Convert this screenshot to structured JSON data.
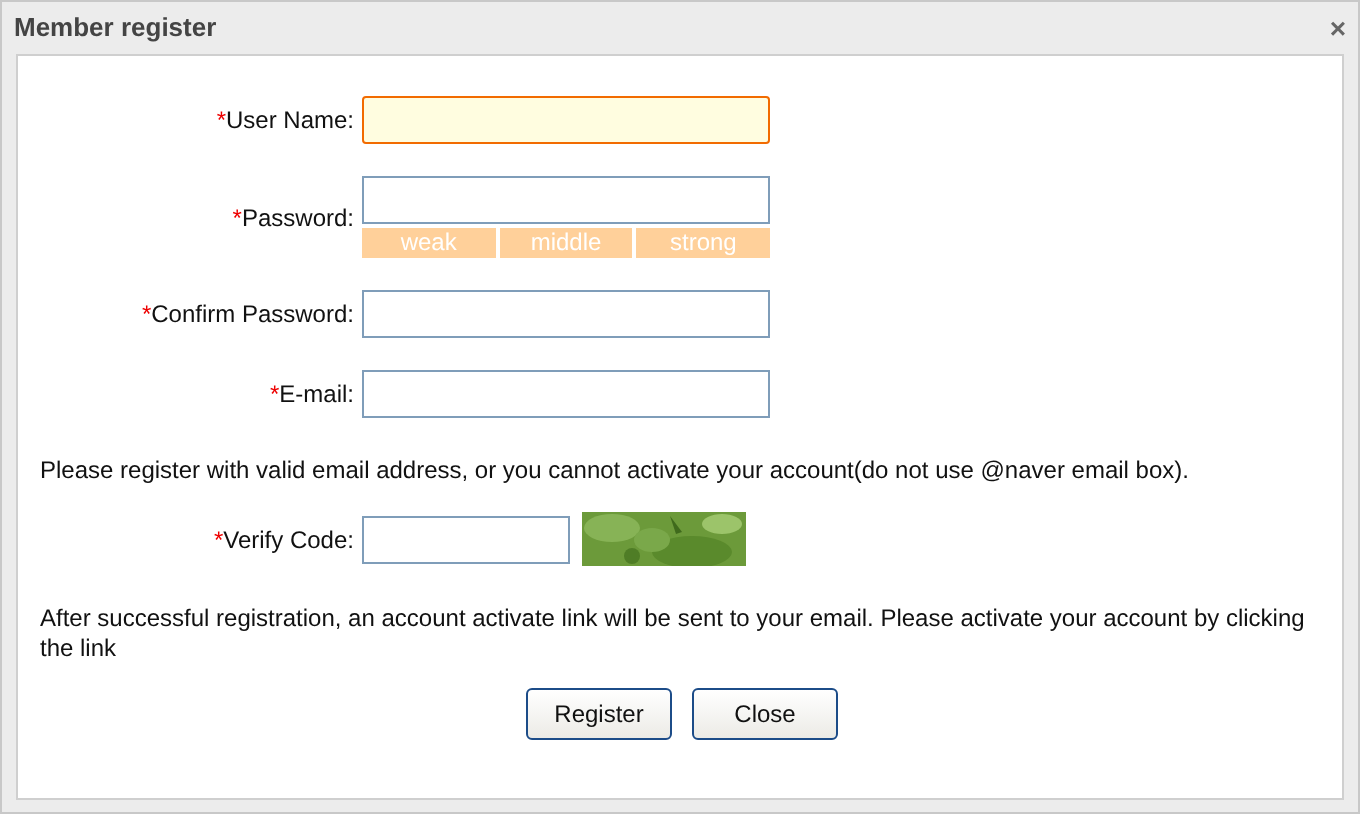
{
  "window": {
    "title": "Member register",
    "close": "×"
  },
  "fields": [
    {
      "kind": "text",
      "required": "*",
      "label": "User Name:",
      "focused": true
    },
    {
      "kind": "password",
      "required": "*",
      "label": "Password:",
      "focused": false,
      "strength": [
        "weak",
        "middle",
        "strong"
      ]
    },
    {
      "kind": "text",
      "required": "*",
      "label": "Confirm Password:",
      "focused": false
    },
    {
      "kind": "text",
      "required": "*",
      "label": "E-mail:",
      "focused": false
    }
  ],
  "email_note": "Please register with valid email address, or you cannot activate your account(do not use @naver email box).",
  "verify": {
    "required": "*",
    "label": "Verify Code:",
    "focused": false
  },
  "activation_note": "After successful registration, an account activate link will be sent to your email. Please activate your account by clicking the link",
  "buttons": [
    "Register",
    "Close"
  ]
}
